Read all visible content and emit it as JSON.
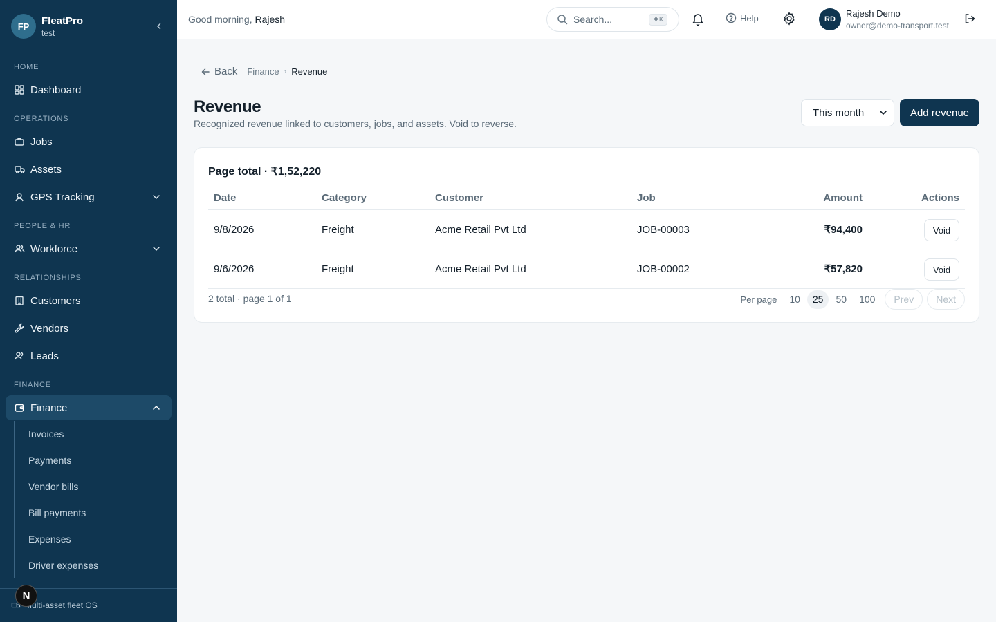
{
  "brand": {
    "initials": "FP",
    "name": "FleatPro",
    "subtitle": "test"
  },
  "sidebar": {
    "sections": [
      {
        "label": "HOME",
        "items": [
          {
            "label": "Dashboard",
            "icon": "dashboard-icon"
          }
        ]
      },
      {
        "label": "OPERATIONS",
        "items": [
          {
            "label": "Jobs",
            "icon": "briefcase-icon"
          },
          {
            "label": "Assets",
            "icon": "truck-icon"
          },
          {
            "label": "GPS Tracking",
            "icon": "map-pin-icon"
          }
        ]
      },
      {
        "label": "PEOPLE & HR",
        "items": [
          {
            "label": "Workforce",
            "icon": "users-icon"
          }
        ]
      },
      {
        "label": "RELATIONSHIPS",
        "items": [
          {
            "label": "Customers",
            "icon": "building-icon"
          },
          {
            "label": "Vendors",
            "icon": "wrench-icon"
          },
          {
            "label": "Leads",
            "icon": "user-plus-icon"
          }
        ]
      },
      {
        "label": "FINANCE",
        "items": [
          {
            "label": "Finance",
            "icon": "wallet-icon"
          }
        ]
      }
    ],
    "finance_sub": [
      "Invoices",
      "Payments",
      "Vendor bills",
      "Bill payments",
      "Expenses",
      "Driver expenses"
    ],
    "footer": "Multi-asset fleet OS",
    "badge": "N"
  },
  "topbar": {
    "greeting": "Good morning,",
    "greeting_name": "Rajesh",
    "search_placeholder": "Search...",
    "search_shortcut": "⌘K",
    "help": "Help",
    "avatar_initials": "RD",
    "user_name": "Rajesh Demo",
    "user_email": "owner@demo-transport.test"
  },
  "breadcrumb": {
    "back": "Back",
    "parent": "Finance",
    "current": "Revenue"
  },
  "page": {
    "title": "Revenue",
    "subtitle": "Recognized revenue linked to customers, jobs, and assets. Void to reverse.",
    "period": "This month",
    "add_button": "Add revenue"
  },
  "table": {
    "page_total": "Page total · ₹1,52,220",
    "columns": [
      "Date",
      "Category",
      "Customer",
      "Job",
      "Amount",
      "Actions"
    ],
    "rows": [
      {
        "date": "9/8/2026",
        "category": "Freight",
        "customer": "Acme Retail Pvt Ltd",
        "job": "JOB-00003",
        "amount": "₹94,400",
        "action": "Void"
      },
      {
        "date": "9/6/2026",
        "category": "Freight",
        "customer": "Acme Retail Pvt Ltd",
        "job": "JOB-00002",
        "amount": "₹57,820",
        "action": "Void"
      }
    ],
    "summary": "2 total · page 1 of 1",
    "per_page_label": "Per page",
    "per_page_options": [
      "10",
      "25",
      "50",
      "100"
    ],
    "per_page_selected": "25",
    "prev": "Prev",
    "next": "Next"
  }
}
